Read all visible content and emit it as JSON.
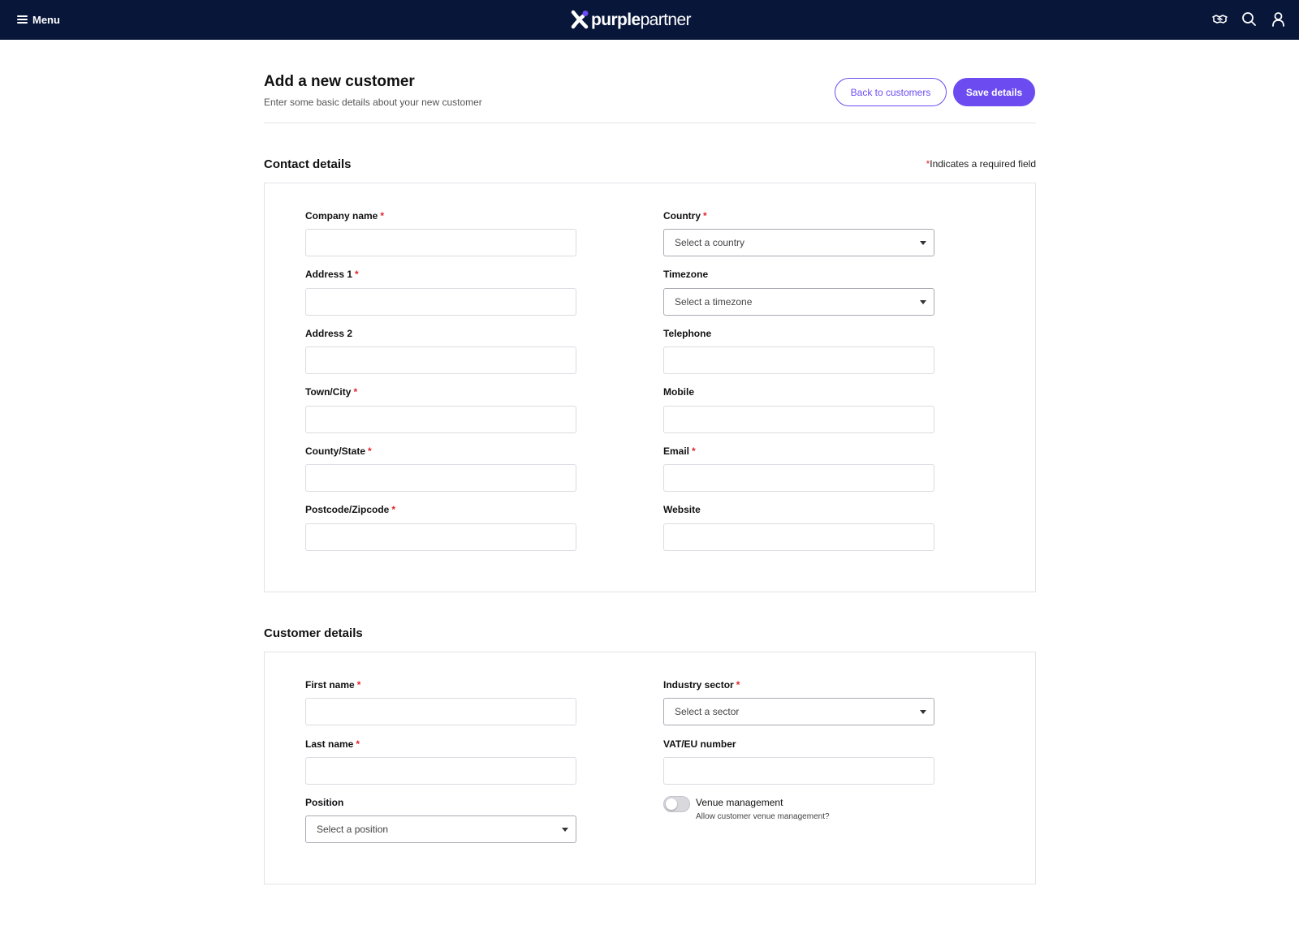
{
  "nav": {
    "menu_label": "Menu",
    "logo_bold": "purple",
    "logo_light": "partner",
    "icons": [
      "handshake-icon",
      "search-icon",
      "user-icon"
    ]
  },
  "header": {
    "title": "Add a new customer",
    "subtitle": "Enter some basic details about your new customer",
    "back_button": "Back to customers",
    "save_button": "Save details"
  },
  "contact": {
    "title": "Contact details",
    "required_star": "*",
    "required_note": "Indicates a required field",
    "company_name": "Company name",
    "address1": "Address 1",
    "address2": "Address 2",
    "town": "Town/City",
    "county": "County/State",
    "postcode": "Postcode/Zipcode",
    "country": "Country",
    "country_placeholder": "Select a country",
    "timezone": "Timezone",
    "timezone_placeholder": "Select a timezone",
    "telephone": "Telephone",
    "mobile": "Mobile",
    "email": "Email",
    "website": "Website"
  },
  "customer": {
    "title": "Customer details",
    "first_name": "First name",
    "last_name": "Last name",
    "position": "Position",
    "position_placeholder": "Select a position",
    "industry": "Industry sector",
    "industry_placeholder": "Select a sector",
    "vat": "VAT/EU number",
    "venue_toggle": "Venue management",
    "venue_help": "Allow customer venue management?",
    "venue_enabled": false
  },
  "colors": {
    "nav_bg": "#08163a",
    "accent": "#6c4cf1",
    "required": "#e0242c"
  }
}
